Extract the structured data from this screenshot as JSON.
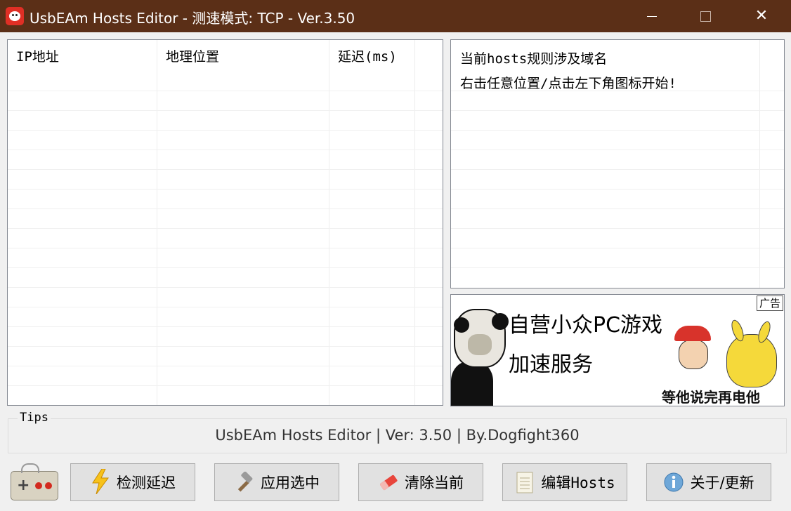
{
  "window": {
    "title": "UsbEAm Hosts Editor - 测速模式: TCP - Ver.3.50",
    "minimize": "—",
    "maximize": "□",
    "close": "✕"
  },
  "ip_list": {
    "columns": [
      "IP地址",
      "地理位置",
      "延迟(ms)"
    ],
    "rows": []
  },
  "hosts_list": {
    "header": "当前hosts规则涉及域名",
    "rows": [
      "右击任意位置/点击左下角图标开始!"
    ]
  },
  "ad": {
    "tag": "广告",
    "line1": "自营小众PC游戏",
    "line2": "加速服务",
    "caption": "等他说完再电他"
  },
  "tips": {
    "label": "Tips",
    "text": "UsbEAm Hosts Editor | Ver: 3.50 | By.Dogfight360"
  },
  "buttons": {
    "detect": "检测延迟",
    "apply": "应用选中",
    "clear": "清除当前",
    "edit": "编辑Hosts",
    "about": "关于/更新"
  },
  "colors": {
    "titlebar": "#5b2f17",
    "background": "#f0f0f0",
    "button": "#e1e1e1"
  }
}
